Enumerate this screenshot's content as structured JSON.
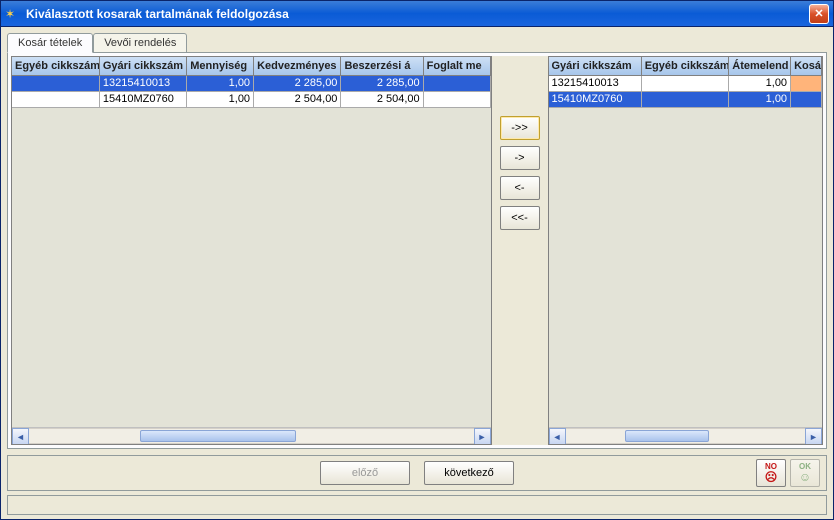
{
  "window": {
    "title": "Kiválasztott kosarak tartalmának feldolgozása"
  },
  "tabs": [
    {
      "label": "Kosár tételek",
      "active": true
    },
    {
      "label": "Vevői rendelés",
      "active": false
    }
  ],
  "left_grid": {
    "columns": [
      "Egyéb cikkszám",
      "Gyári cikkszám",
      "Mennyiség",
      "Kedvezményes",
      "Beszerzési á",
      "Foglalt me"
    ],
    "rows": [
      {
        "cells": [
          "",
          "13215410013",
          "1,00",
          "2 285,00",
          "2 285,00",
          ""
        ],
        "selected": true
      },
      {
        "cells": [
          "",
          "15410MZ0760",
          "1,00",
          "2 504,00",
          "2 504,00",
          ""
        ],
        "selected": false
      }
    ]
  },
  "right_grid": {
    "columns": [
      "Gyári cikkszám",
      "Egyéb cikkszám",
      "Átemelend",
      "Kosá"
    ],
    "rows": [
      {
        "cells": [
          "13215410013",
          "",
          "1,00",
          ""
        ],
        "selected": false,
        "flag_last": true
      },
      {
        "cells": [
          "15410MZ0760",
          "",
          "1,00",
          ""
        ],
        "selected": true
      }
    ]
  },
  "transfer_buttons": {
    "all_right": "->>",
    "one_right": "->",
    "one_left": "<-",
    "all_left": "<<-"
  },
  "footer": {
    "prev": "előző",
    "next": "következő",
    "no": "NO",
    "ok": "OK"
  },
  "chart_data": {
    "type": "table",
    "left": {
      "columns": [
        "Egyéb cikkszám",
        "Gyári cikkszám",
        "Mennyiség",
        "Kedvezményes",
        "Beszerzési ár",
        "Foglalt mennyiség"
      ],
      "rows": [
        [
          "",
          "13215410013",
          1.0,
          2285.0,
          2285.0,
          null
        ],
        [
          "",
          "15410MZ0760",
          1.0,
          2504.0,
          2504.0,
          null
        ]
      ]
    },
    "right": {
      "columns": [
        "Gyári cikkszám",
        "Egyéb cikkszám",
        "Átemelendő",
        "Kosár"
      ],
      "rows": [
        [
          "13215410013",
          "",
          1.0,
          null
        ],
        [
          "15410MZ0760",
          "",
          1.0,
          null
        ]
      ]
    }
  }
}
